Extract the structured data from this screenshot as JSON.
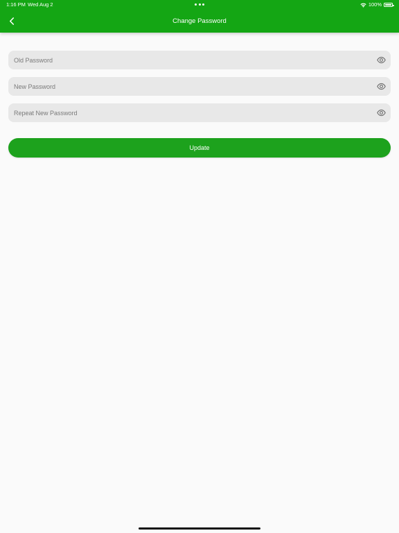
{
  "status_bar": {
    "time": "1:16 PM",
    "date": "Wed Aug 2",
    "battery": "100%"
  },
  "header": {
    "title": "Change Password",
    "back_icon": "chevron-left-icon"
  },
  "form": {
    "old_password": {
      "placeholder": "Old Password",
      "value": "",
      "icon": "eye-icon"
    },
    "new_password": {
      "placeholder": "New Password",
      "value": "",
      "icon": "eye-icon"
    },
    "repeat_password": {
      "placeholder": "Repeat New Password",
      "value": "",
      "icon": "eye-icon"
    },
    "submit_label": "Update"
  },
  "colors": {
    "header_green": "#14a614",
    "button_green": "#1da21d",
    "field_bg": "#e8e8e8",
    "page_bg": "#fafafa"
  }
}
